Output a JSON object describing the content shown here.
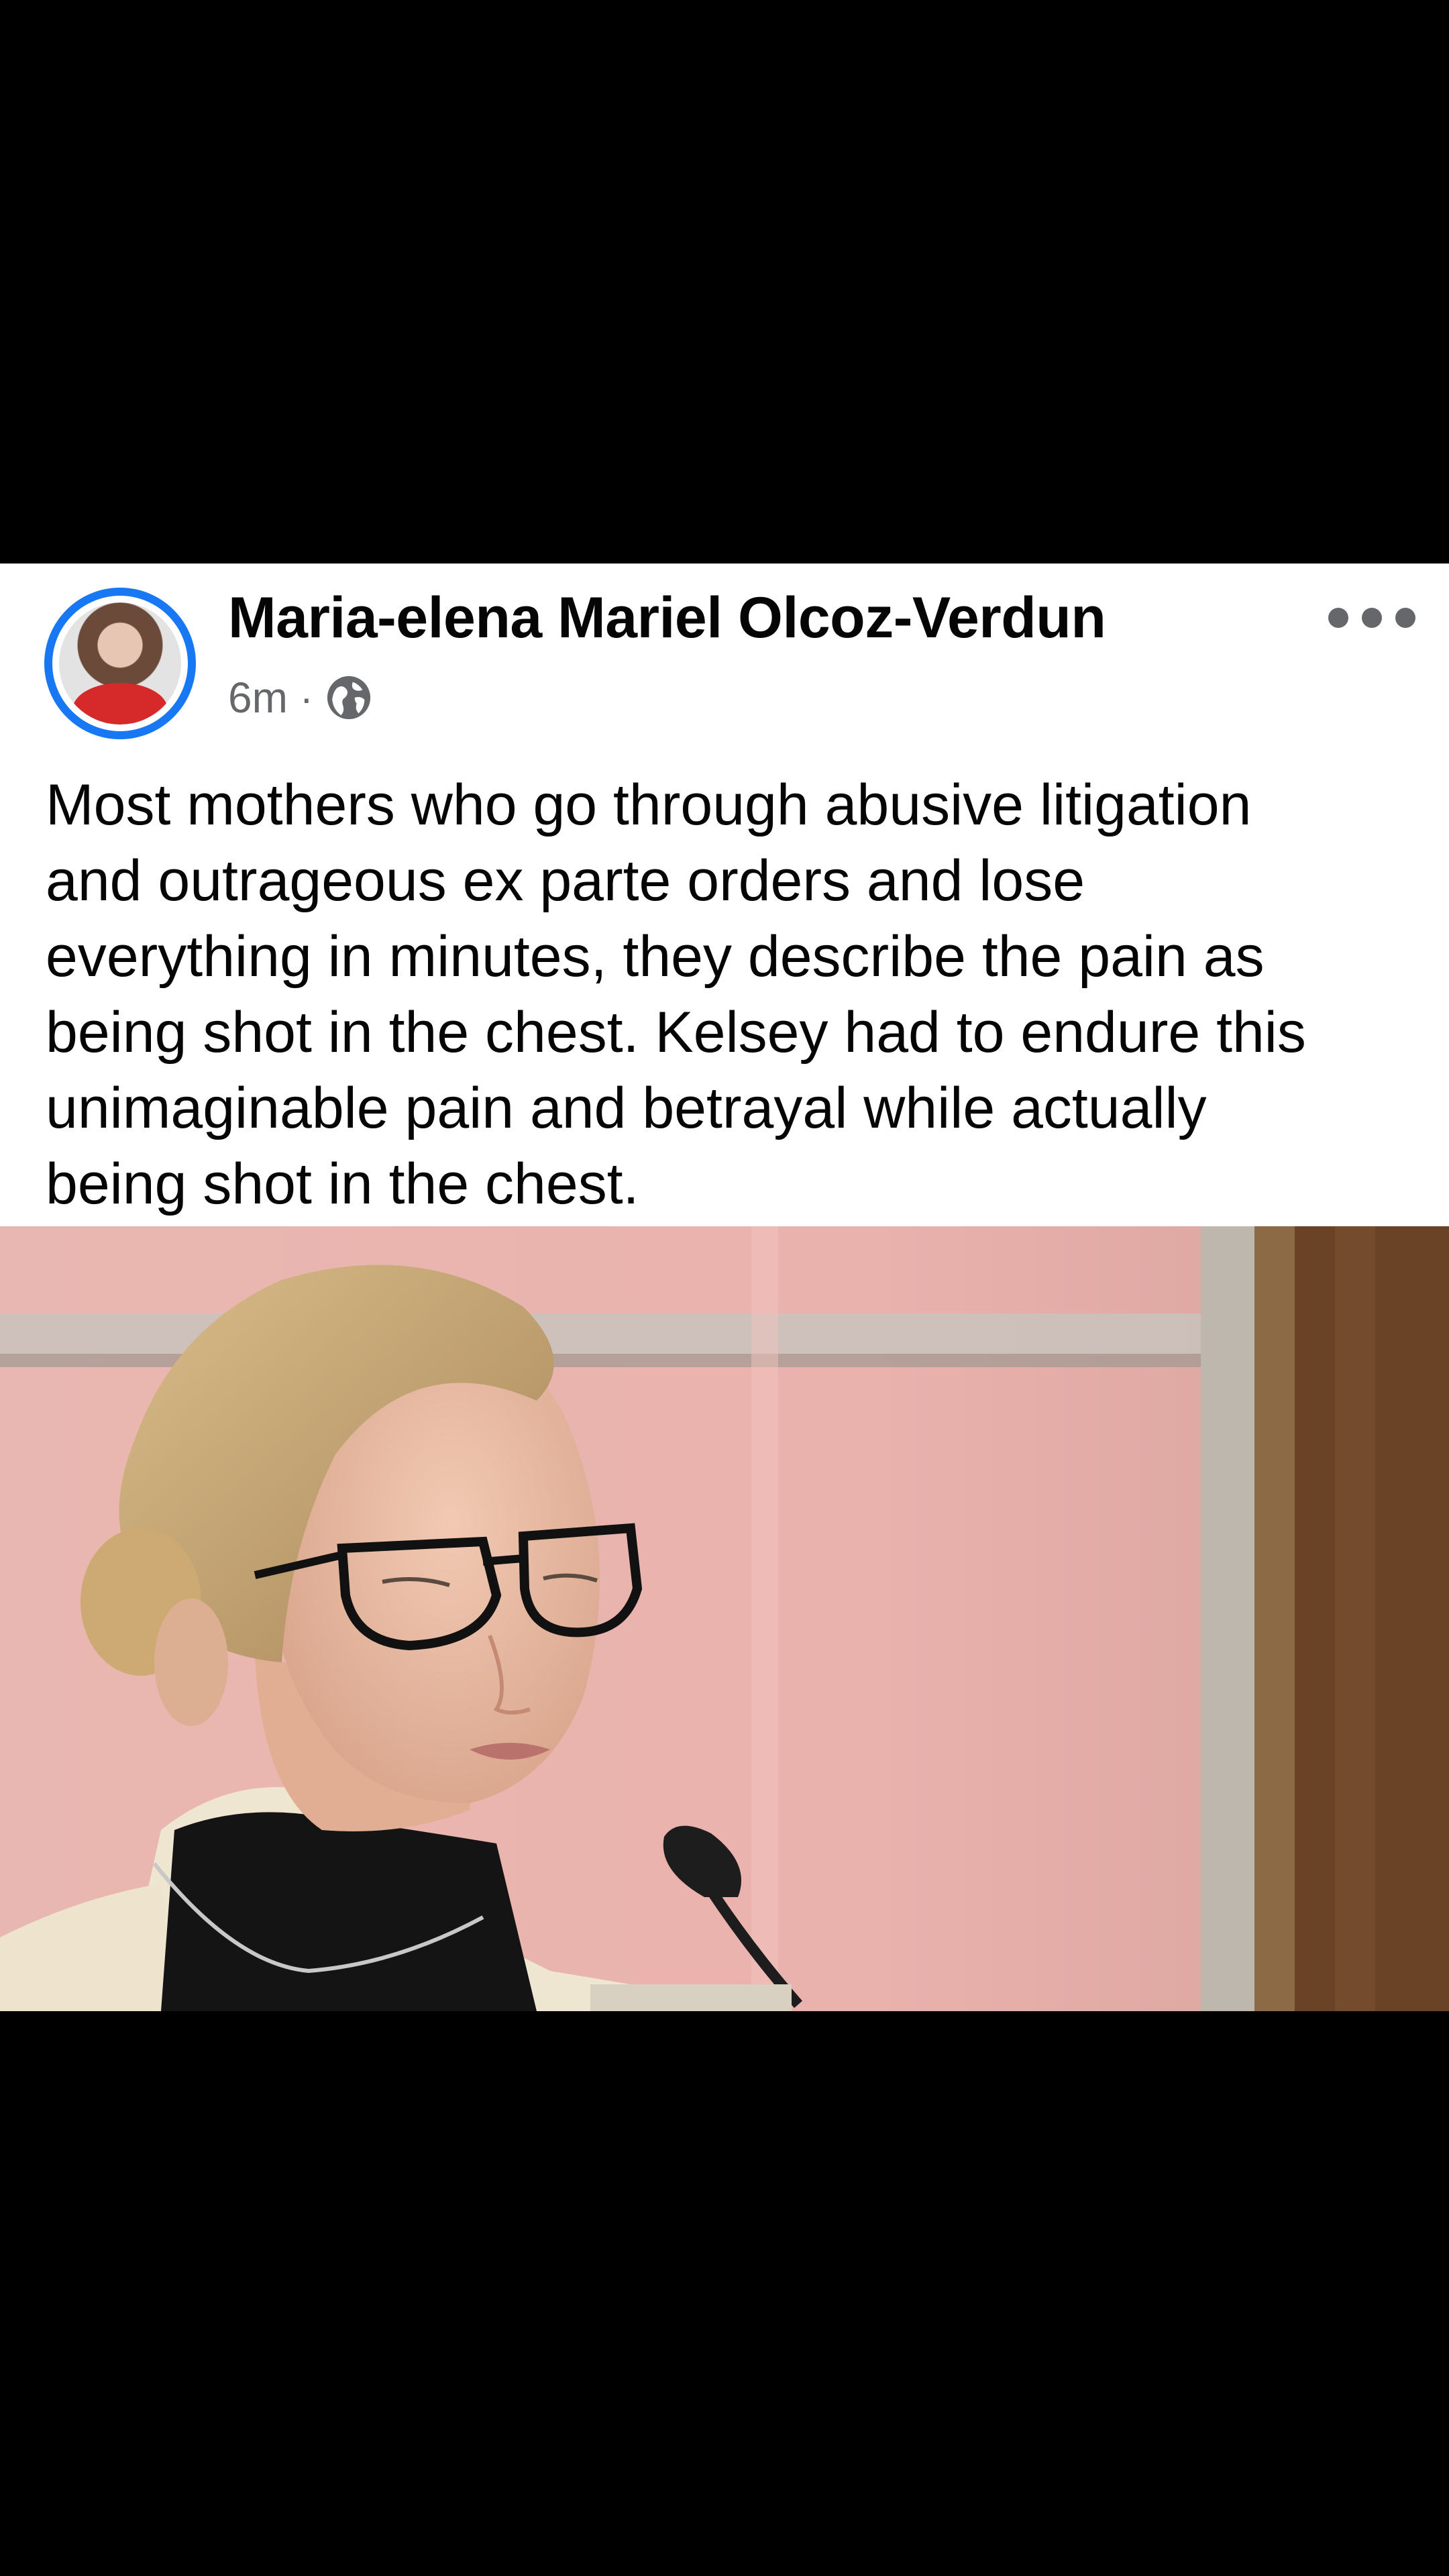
{
  "post": {
    "author_name": "Maria-elena Mariel Olcoz-Verdun",
    "timestamp": "6m",
    "separator": "·",
    "privacy_icon": "globe-icon",
    "more_icon": "more-options-icon",
    "text_lines": [
      "Most mothers who go through abusive litigation",
      "and outrageous ex parte orders and lose",
      "everything in minutes, they describe the pain as",
      "being shot in the chest.  Kelsey had to endure this",
      "unimaginable pain and betrayal while actually",
      "being shot in the chest."
    ],
    "image_subject": "woman-with-glasses-at-microphone-photo"
  },
  "colors": {
    "background": "#000000",
    "card": "#ffffff",
    "name_text": "#050505",
    "meta_text": "#65676b",
    "avatar_ring": "#1877f2"
  }
}
